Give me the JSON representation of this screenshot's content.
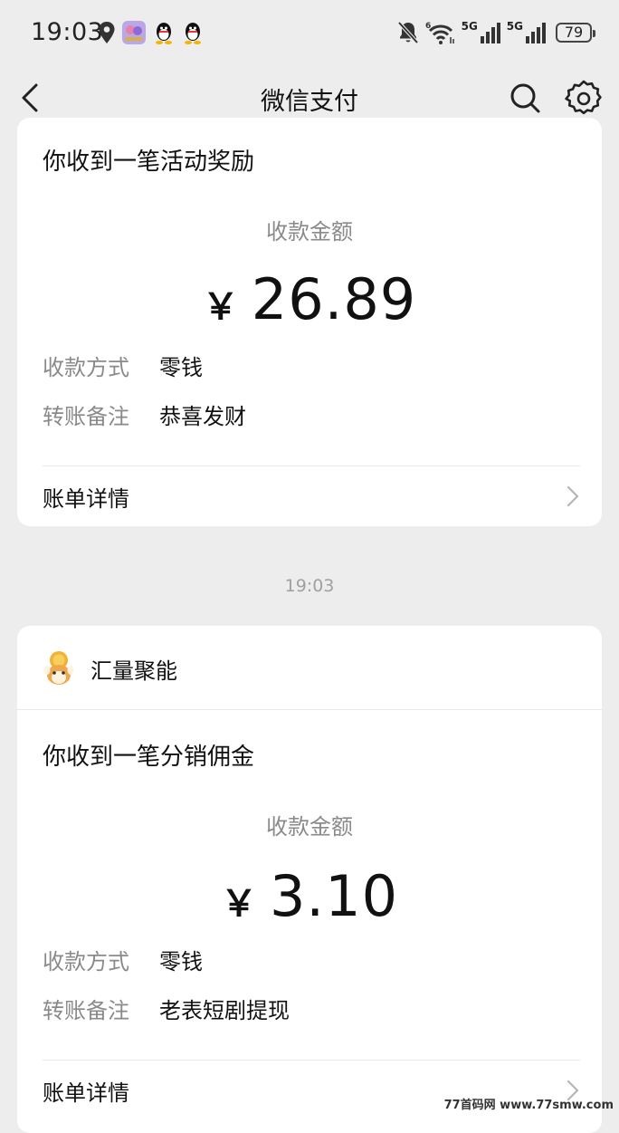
{
  "status_bar": {
    "time": "19:03",
    "net1": "5G",
    "net2": "5G",
    "battery": "79",
    "icons": [
      "location-icon",
      "app-icon",
      "qq-icon",
      "qq-icon",
      "mute-bell-icon",
      "wifi-icon",
      "signal-icon",
      "signal-icon",
      "battery-icon"
    ]
  },
  "nav": {
    "title": "微信支付"
  },
  "card1": {
    "title": "你收到一笔活动奖励",
    "amount_label": "收款金额",
    "currency": "￥",
    "amount": "26.89",
    "rows": [
      {
        "key": "收款方式",
        "value": "零钱"
      },
      {
        "key": "转账备注",
        "value": "恭喜发财"
      }
    ],
    "detail_label": "账单详情"
  },
  "timestamp": "19:03",
  "card2": {
    "merchant": "汇量聚能",
    "title": "你收到一笔分销佣金",
    "amount_label": "收款金额",
    "currency": "￥",
    "amount": "3.10",
    "rows": [
      {
        "key": "收款方式",
        "value": "零钱"
      },
      {
        "key": "转账备注",
        "value": "老表短剧提现"
      }
    ],
    "detail_label": "账单详情"
  },
  "watermark": "77首码网 www.77smw.com"
}
